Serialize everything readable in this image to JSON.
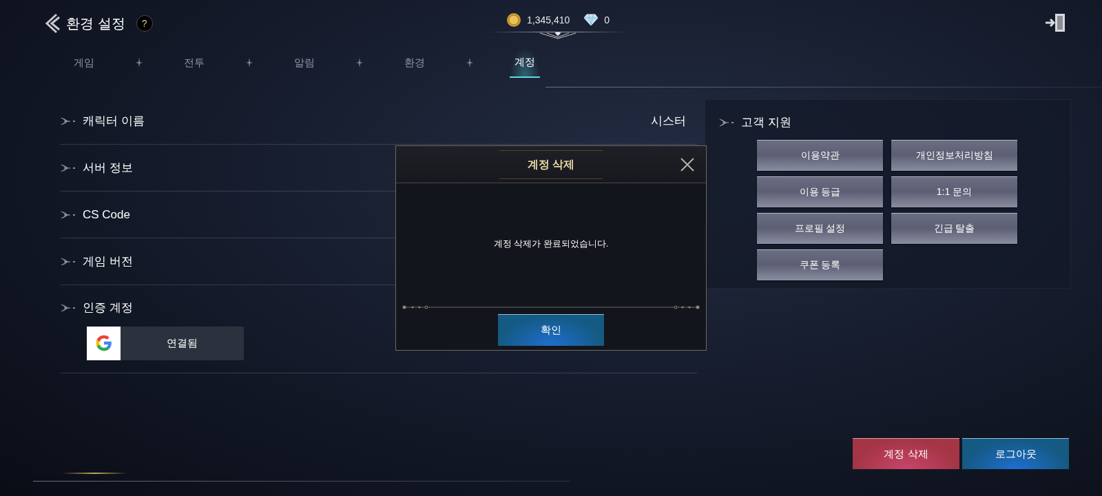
{
  "header": {
    "title": "환경 설정",
    "help": "?"
  },
  "currencies": [
    {
      "kind": "gold",
      "amount": "1,345,410"
    },
    {
      "kind": "diamond",
      "amount": "0"
    }
  ],
  "tabs": [
    {
      "label": "게임",
      "selected": false
    },
    {
      "label": "전투",
      "selected": false
    },
    {
      "label": "알림",
      "selected": false
    },
    {
      "label": "환경",
      "selected": false
    },
    {
      "label": "계정",
      "selected": true
    }
  ],
  "settings": [
    {
      "kind": "text",
      "label": "캐릭터 이름",
      "value": "시스터"
    },
    {
      "kind": "text",
      "label": "서버 정보"
    },
    {
      "kind": "text",
      "label": "CS Code"
    },
    {
      "kind": "text",
      "label": "게임 버전"
    },
    {
      "kind": "account",
      "label": "인증 계정",
      "status": "연결됨"
    }
  ],
  "support": {
    "title": "고객 지원",
    "buttons": [
      "이용약관",
      "개인정보처리방침",
      "이용 등급",
      "1:1 문의",
      "프로필 설정",
      "긴급 탈출",
      "쿠폰 등록"
    ]
  },
  "footer_buttons": [
    {
      "kind": "danger",
      "label": "계정 삭제"
    },
    {
      "kind": "primary",
      "label": "로그아웃"
    }
  ],
  "dialog": {
    "title": "계정 삭제",
    "message": "계정 삭제가 완료되었습니다.",
    "confirm": "확인"
  }
}
